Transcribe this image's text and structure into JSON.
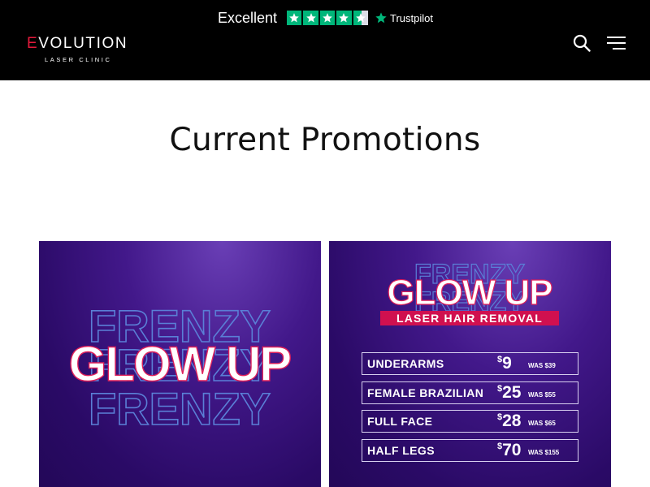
{
  "trustpilot": {
    "rating_word": "Excellent",
    "stars_filled": 4.5,
    "stars_total": 5,
    "brand": "Trustpilot",
    "star_color": "#00b67a"
  },
  "logo": {
    "first_letter": "E",
    "rest": "VOLUTION",
    "subtitle": "LASER CLINIC",
    "accent_color": "#e21a3b"
  },
  "header_icons": [
    "search-icon",
    "menu-icon"
  ],
  "page": {
    "title": "Current Promotions"
  },
  "promo_left": {
    "headline": "GLOW UP",
    "outline_word": "FRENZY"
  },
  "promo_right": {
    "headline": "GLOW UP",
    "outline_word": "FRENZY",
    "banner": "LASER HAIR REMOVAL",
    "banner_color": "#d0104f",
    "items": [
      {
        "name": "UNDERARMS",
        "currency": "$",
        "price": "9",
        "was": "WAS $39"
      },
      {
        "name": "FEMALE BRAZILIAN",
        "currency": "$",
        "price": "25",
        "was": "WAS $55"
      },
      {
        "name": "FULL FACE",
        "currency": "$",
        "price": "28",
        "was": "WAS $65"
      },
      {
        "name": "HALF LEGS",
        "currency": "$",
        "price": "70",
        "was": "WAS $155"
      }
    ]
  }
}
